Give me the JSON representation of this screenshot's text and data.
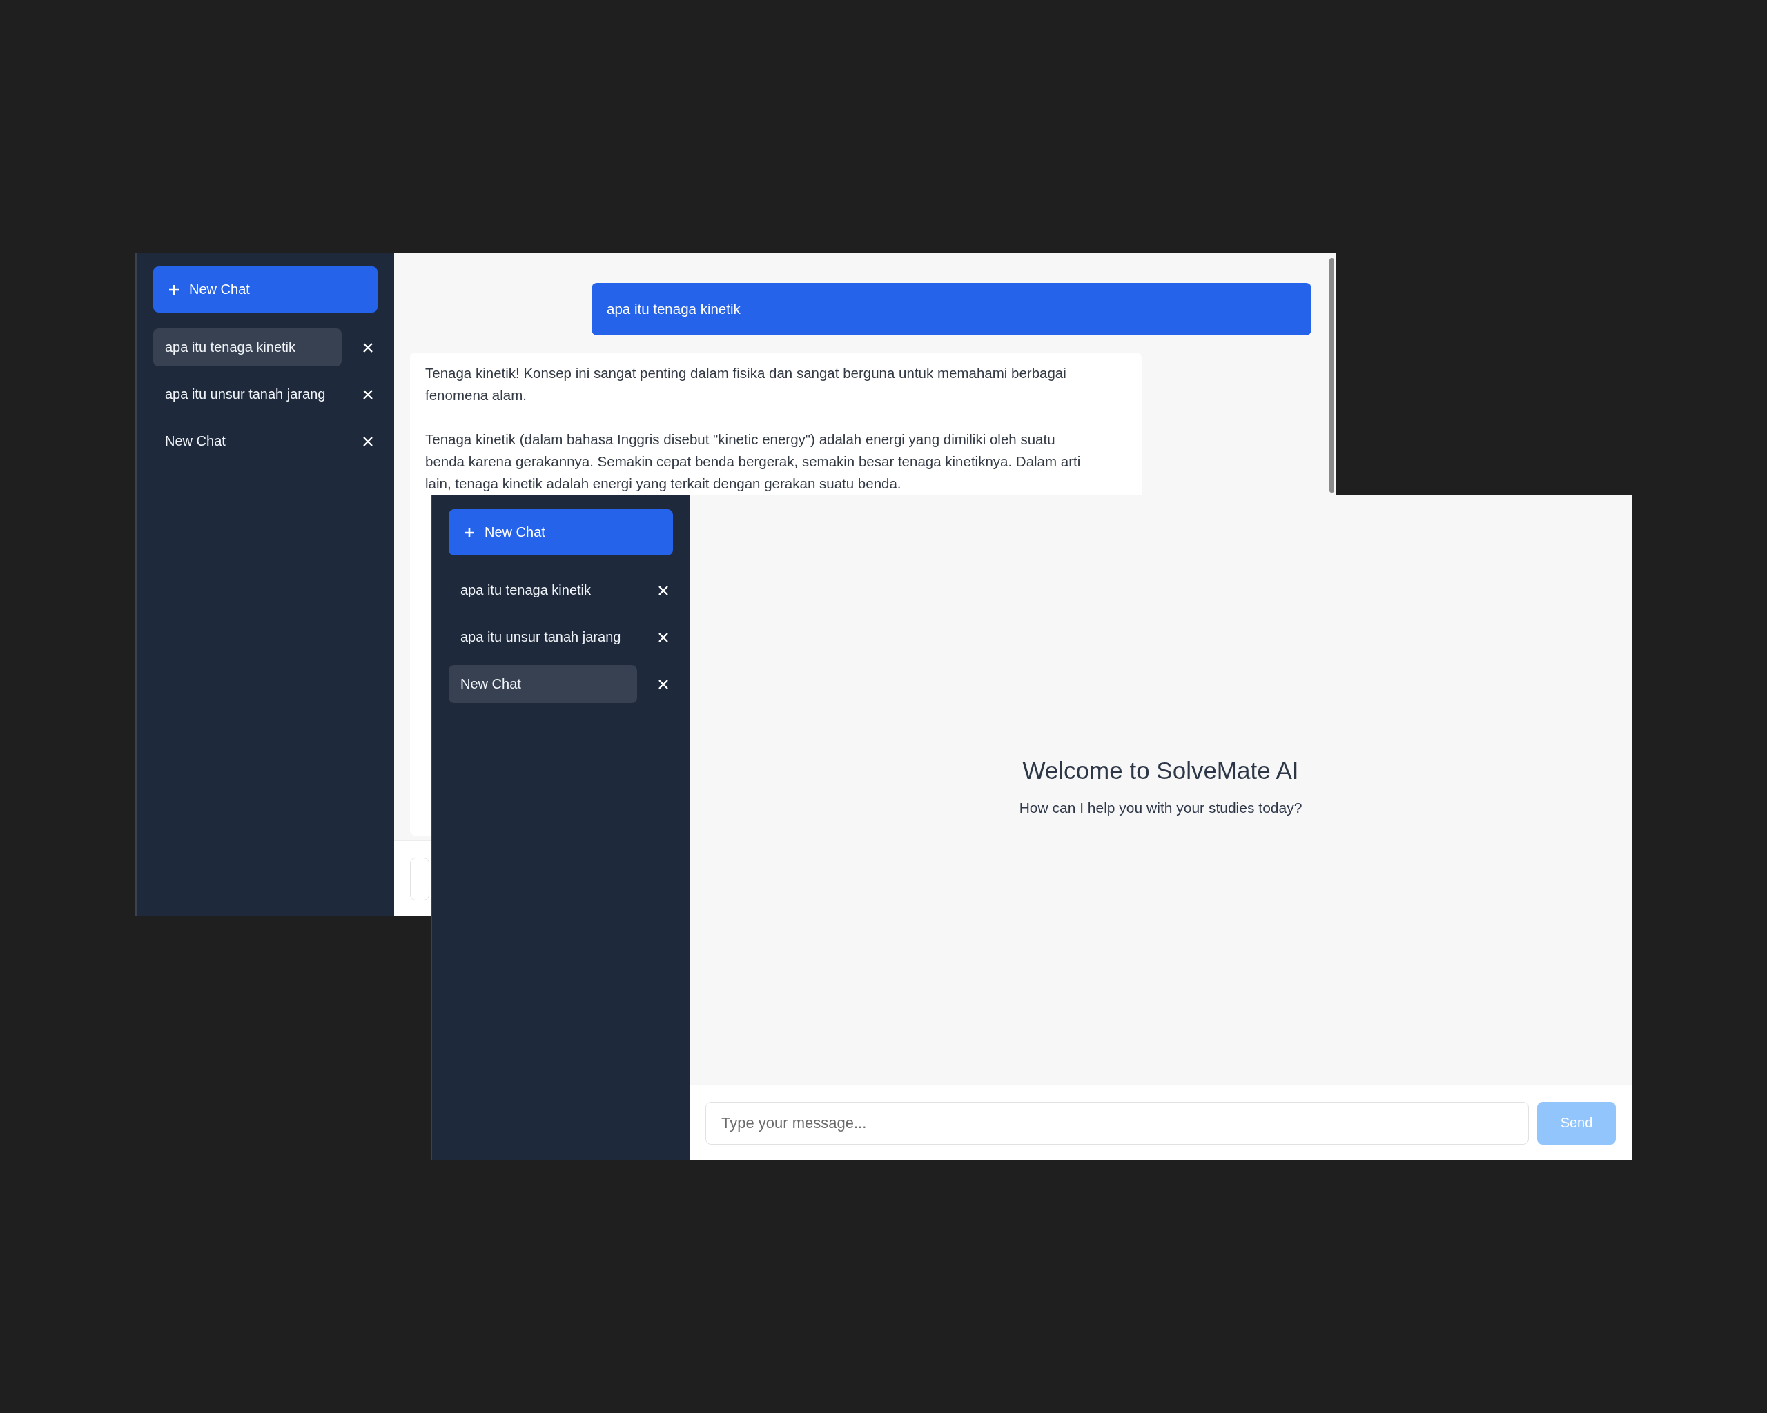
{
  "windows": [
    {
      "sidebar": {
        "new_chat_label": "New Chat",
        "chats": [
          {
            "title": "apa itu tenaga kinetik",
            "selected": true
          },
          {
            "title": "apa itu unsur tanah jarang",
            "selected": false
          },
          {
            "title": "New Chat",
            "selected": false
          }
        ]
      },
      "messages": [
        {
          "kind": "user",
          "paragraphs": [
            [
              "apa itu tenaga kinetik"
            ]
          ]
        },
        {
          "kind": "assistant",
          "paragraphs": [
            [
              "Tenaga kinetik! Konsep ini sangat penting dalam fisika dan sangat berguna untuk memahami berbagai",
              "fenomena alam."
            ],
            [
              "Tenaga kinetik (dalam bahasa Inggris disebut \"kinetic energy\") adalah energi yang dimiliki oleh suatu",
              "benda karena gerakannya. Semakin cepat benda bergerak, semakin besar tenaga kinetiknya. Dalam arti",
              "lain, tenaga kinetik adalah energi yang terkait dengan gerakan suatu benda."
            ]
          ]
        }
      ]
    },
    {
      "sidebar": {
        "new_chat_label": "New Chat",
        "chats": [
          {
            "title": "apa itu tenaga kinetik",
            "selected": false
          },
          {
            "title": "apa itu unsur tanah jarang",
            "selected": false
          },
          {
            "title": "New Chat",
            "selected": true
          }
        ]
      },
      "welcome": {
        "title": "Welcome to SolveMate AI",
        "subtitle": "How can I help you with your studies today?"
      },
      "input": {
        "placeholder": "Type your message..."
      },
      "send_button": {
        "label": "Send",
        "disabled": true
      }
    }
  ]
}
